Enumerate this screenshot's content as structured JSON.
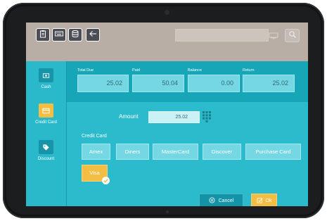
{
  "toolbar": {
    "buttons": [
      {
        "icon": "clipboard-icon"
      },
      {
        "icon": "keyboard-icon"
      },
      {
        "icon": "database-icon"
      },
      {
        "icon": "back-arrow-icon"
      }
    ],
    "search": {
      "value": "",
      "keyboard_icon": "keyboard-icon",
      "search_icon": "search-icon"
    }
  },
  "sidebar": {
    "items": [
      {
        "label": "Cash",
        "icon": "cash-icon",
        "selected": false
      },
      {
        "label": "Credit Card",
        "icon": "credit-card-icon",
        "selected": true
      },
      {
        "label": "Discount",
        "icon": "tag-icon",
        "selected": false
      }
    ]
  },
  "totals": [
    {
      "label": "Total Due",
      "value": "25.02"
    },
    {
      "label": "Paid",
      "value": "50.04"
    },
    {
      "label": "Balance",
      "value": "0.00"
    },
    {
      "label": "Return",
      "value": "25.02"
    }
  ],
  "amount": {
    "label": "Amount",
    "value": "25.02"
  },
  "credit_card": {
    "title": "Credit Card",
    "options": [
      "Amex",
      "Diners",
      "MasterCard",
      "Discover",
      "Purchase Card"
    ],
    "selected": "Visa"
  },
  "actions": {
    "cancel": "Cancel",
    "ok": "Ok"
  },
  "colors": {
    "bezel": "#1c1d1f",
    "topbar": "#b8aea5",
    "panel": "#2bbbcc",
    "totals_bar": "#16a6b8",
    "field": "#74d7e3",
    "accent": "#f3be43",
    "cancel": "#1393a7"
  }
}
